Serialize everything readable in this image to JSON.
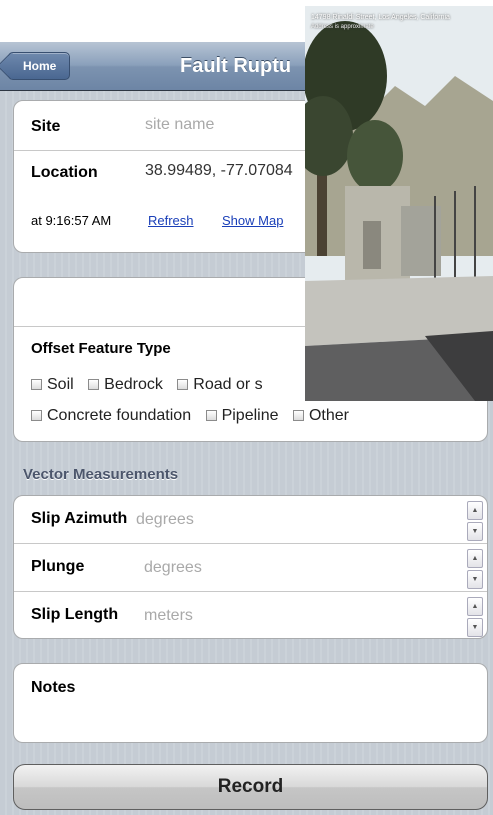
{
  "nav": {
    "back_label": "Home",
    "title": "Fault Ruptu"
  },
  "site": {
    "label": "Site",
    "placeholder": "site name"
  },
  "location": {
    "label": "Location",
    "value": "38.99489, -77.07084",
    "time": "at 9:16:57 AM",
    "refresh": "Refresh",
    "show_map": "Show Map"
  },
  "offset": {
    "title": "Offset Feature Type",
    "options_row1": [
      "Soil",
      "Bedrock",
      "Road or s"
    ],
    "options_row2": [
      "Concrete foundation",
      "Pipeline",
      "Other"
    ]
  },
  "vector": {
    "header": "Vector Measurements",
    "rows": [
      {
        "label": "Slip Azimuth",
        "placeholder": "degrees"
      },
      {
        "label": "Plunge",
        "placeholder": "degrees"
      },
      {
        "label": "Slip Length",
        "placeholder": "meters"
      }
    ]
  },
  "notes": {
    "label": "Notes"
  },
  "record": {
    "label": "Record"
  },
  "photo": {
    "caption": "14798 Rinaldi Street, Los Angeles, California",
    "caption2": "Address is approximate"
  }
}
